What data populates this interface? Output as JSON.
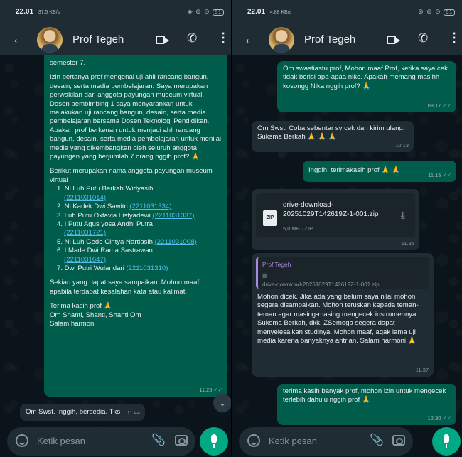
{
  "contact": "Prof Tegeh",
  "composer_placeholder": "Ketik pesan",
  "left": {
    "status_time": "22.01",
    "status_signal": "37.5 KB/s",
    "battery": "51",
    "long_message": {
      "p1": "semester 7.",
      "p2": "Izin bertanya prof mengenai uji ahli rancang bangun, desain, serta media pembelajaran. Saya merupakan perwakilan dari anggota payungan museum virtual. Dosen pembimbing 1 saya menyarankan untuk melakukan uji rancang bangun, desain, serta media pembelajaran bersama Dosen Teknologi Pendidikan. Apakah prof berkenan untuk menjadi ahli rancang bangun, desain, serta media pembelajaran untuk menilai media yang dikembangkan oleh seluruh anggota payungan yang berjumlah 7 orang nggih prof? 🙏",
      "p3": "Berikut merupakan nama anggota payungan museum virtual",
      "members": [
        {
          "name": "1. Ni Luh Putu Berkah Widyasih",
          "nim": "(2211031014)"
        },
        {
          "name": "2. Ni Kadek Dwi Sawitri",
          "nim": "(2211031334)"
        },
        {
          "name": "3. Luh Putu Oxtavia Listyadewi",
          "nim": "(2211031337)"
        },
        {
          "name": "4. I Putu Agus yosa Andhi Putra",
          "nim": "(2211031721)"
        },
        {
          "name": "5. Ni Luh Gede Cintya Nartiasih",
          "nim": "(2211031008)"
        },
        {
          "name": "6. I Made Dwi Rama Sastrawan",
          "nim": "(2211031647)"
        },
        {
          "name": "7. Dwi Putri Wulandari",
          "nim": "(2211031310)"
        }
      ],
      "p4": "Sekian yang dapat saya sampaikan. Mohon maaf apabila terdapat kesalahan kata atau kalimat.",
      "p5a": "Terima kasih prof 🙏",
      "p5b": "Om Shanti, Shanti, Shanti Om",
      "p5c": "Salam harmoni",
      "time": "11.25"
    },
    "reply": {
      "text": "Om Swst. Inggih, bersedia. Tks",
      "time": "11.44"
    }
  },
  "right": {
    "status_time": "22.01",
    "status_signal": "4.88 KB/s",
    "battery": "51",
    "m1": {
      "text": "Om swastiastu prof, Mohon maaf Prof, ketika saya cek tidak berisi apa-apaa nike. Apakah memang masihh kosongg Nika nggih prof? 🙏",
      "time": "08.17"
    },
    "m2": {
      "text": "Om Swst. Coba sebentar sy cek dan kirim ulang. Suksma Berkah 🙏 🙏 🙏",
      "time": "10.13"
    },
    "m3": {
      "text": "Inggih, terimakasih prof 🙏 🙏",
      "time": "11.15"
    },
    "m4": {
      "file_name": "drive-download-20251029T142619Z-1-001.zip",
      "file_meta": "5,0 MB · ZIP",
      "badge": "ZIP",
      "time": "11.35"
    },
    "m5": {
      "quote_name": "Prof Tegeh",
      "quote_file": "drive-download-20251029T142619Z-1-001.zip",
      "text": "Mohon dicek. Jika ada yang belum saya nilai mohon segera disampaikan. Mohon teruskan kepada teman-teman agar masing-masing mengecek instrumennya. Suksma Berkah, dkk. ZSemoga segera dapat menyelesaikan studinya. Mohon maaf, agak lama uji media karena banyaknya antrian. Salam harmoni 🙏",
      "time": "11.37"
    },
    "m6": {
      "text": "terima kasih banyak prof, mohon izin untuk mengecek terlebih dahulu nggih prof 🙏",
      "time": "12.30"
    }
  }
}
